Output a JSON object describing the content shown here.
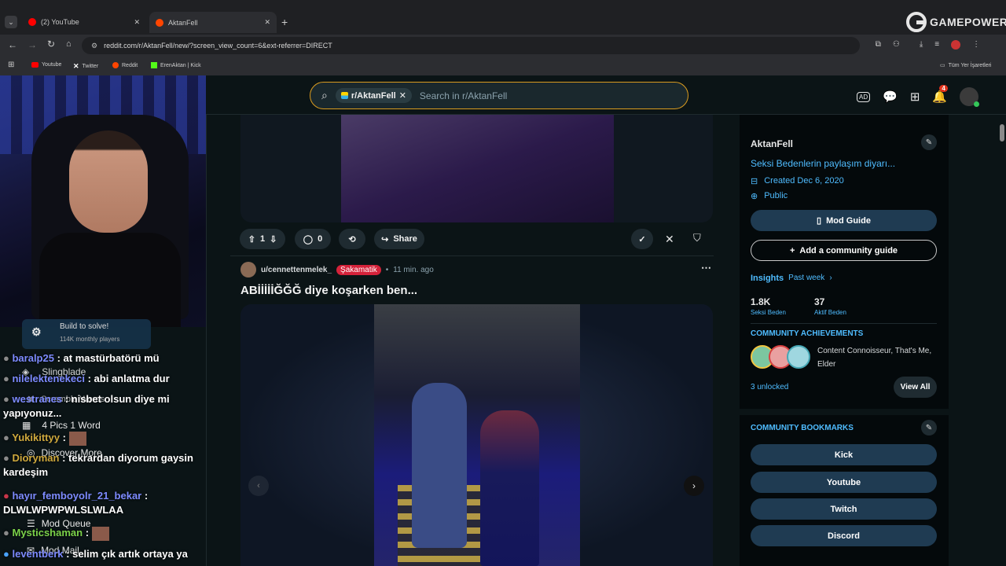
{
  "browser": {
    "tabs": [
      {
        "label": "(2) YouTube",
        "favicon_color": "#ff0000"
      },
      {
        "label": "AktanFell",
        "favicon_color": "#ff4500"
      }
    ],
    "url": "reddit.com/r/AktanFell/new/?screen_view_count=6&ext-referrer=DIRECT",
    "bookmarks": [
      {
        "label": "Youtube",
        "color": "#ff0000"
      },
      {
        "label": "Twitter",
        "color": "#ffffff"
      },
      {
        "label": "Reddit",
        "color": "#ff4500"
      },
      {
        "label": "ErenAktan | Kick",
        "color": "#53fc18"
      }
    ],
    "all_bookmarks": "Tüm Yer İşaretleri",
    "watermark": "GAMEPOWER"
  },
  "header": {
    "chip_label": "r/AktanFell",
    "search_placeholder": "Search in r/AktanFell",
    "notification_count": "4"
  },
  "post_actions": {
    "vote_count": "1",
    "comment_count": "0",
    "share_label": "Share"
  },
  "post": {
    "author": "u/cennettenmelek_",
    "flair": "Şakamatik",
    "time": "11 min. ago",
    "title": "ABİİİİİĞĞĞ diye koşarken ben..."
  },
  "sidebar": {
    "name": "AktanFell",
    "description": "Seksi Bedenlerin paylaşım diyarı...",
    "created": "Created Dec 6, 2020",
    "visibility": "Public",
    "mod_guide": "Mod Guide",
    "add_guide": "Add a community guide",
    "insights": "Insights",
    "past_week": "Past week",
    "stat1_value": "1.8K",
    "stat1_label": "Seksi Beden",
    "stat2_value": "37",
    "stat2_label": "Aktif Beden",
    "achievements_title": "COMMUNITY ACHIEVEMENTS",
    "achievements_text": "Content Connoisseur, That's Me, Elder",
    "unlocked": "3 unlocked",
    "view_all": "View All",
    "bookmarks_title": "COMMUNITY BOOKMARKS",
    "bookmark_buttons": [
      "Kick",
      "Youtube",
      "Twitch",
      "Discord"
    ]
  },
  "stream": {
    "popup_title": "Build to solve!",
    "popup_sub": "114K monthly players",
    "chat": [
      {
        "user": "baralp25",
        "msg": ": at mastürbatörü mü"
      },
      {
        "user": "nilelektenekeci",
        "msg": ": abi anlatma dur"
      },
      {
        "user": "westranes",
        "msg": ": nisbet olsun diye mi yapıyonuz..."
      },
      {
        "user": "Yukikittyy",
        "msg": ":"
      },
      {
        "user": "Dioryman",
        "msg": ": tekrardan diyorum gaysin kardeşim"
      },
      {
        "user": "hayır_femboyolr_21_bekar",
        "msg": ": DLWLWPWPWLSLWLAA"
      },
      {
        "user": "Mysticshaman",
        "msg": ":"
      },
      {
        "user": "leventberk",
        "msg": ": selim çık artık ortaya ya"
      }
    ],
    "menu": [
      "Slingblade",
      "Scramble Words",
      "4 Pics 1 Word",
      "Discover More",
      "Mod Queue",
      "Mod Mail"
    ]
  }
}
